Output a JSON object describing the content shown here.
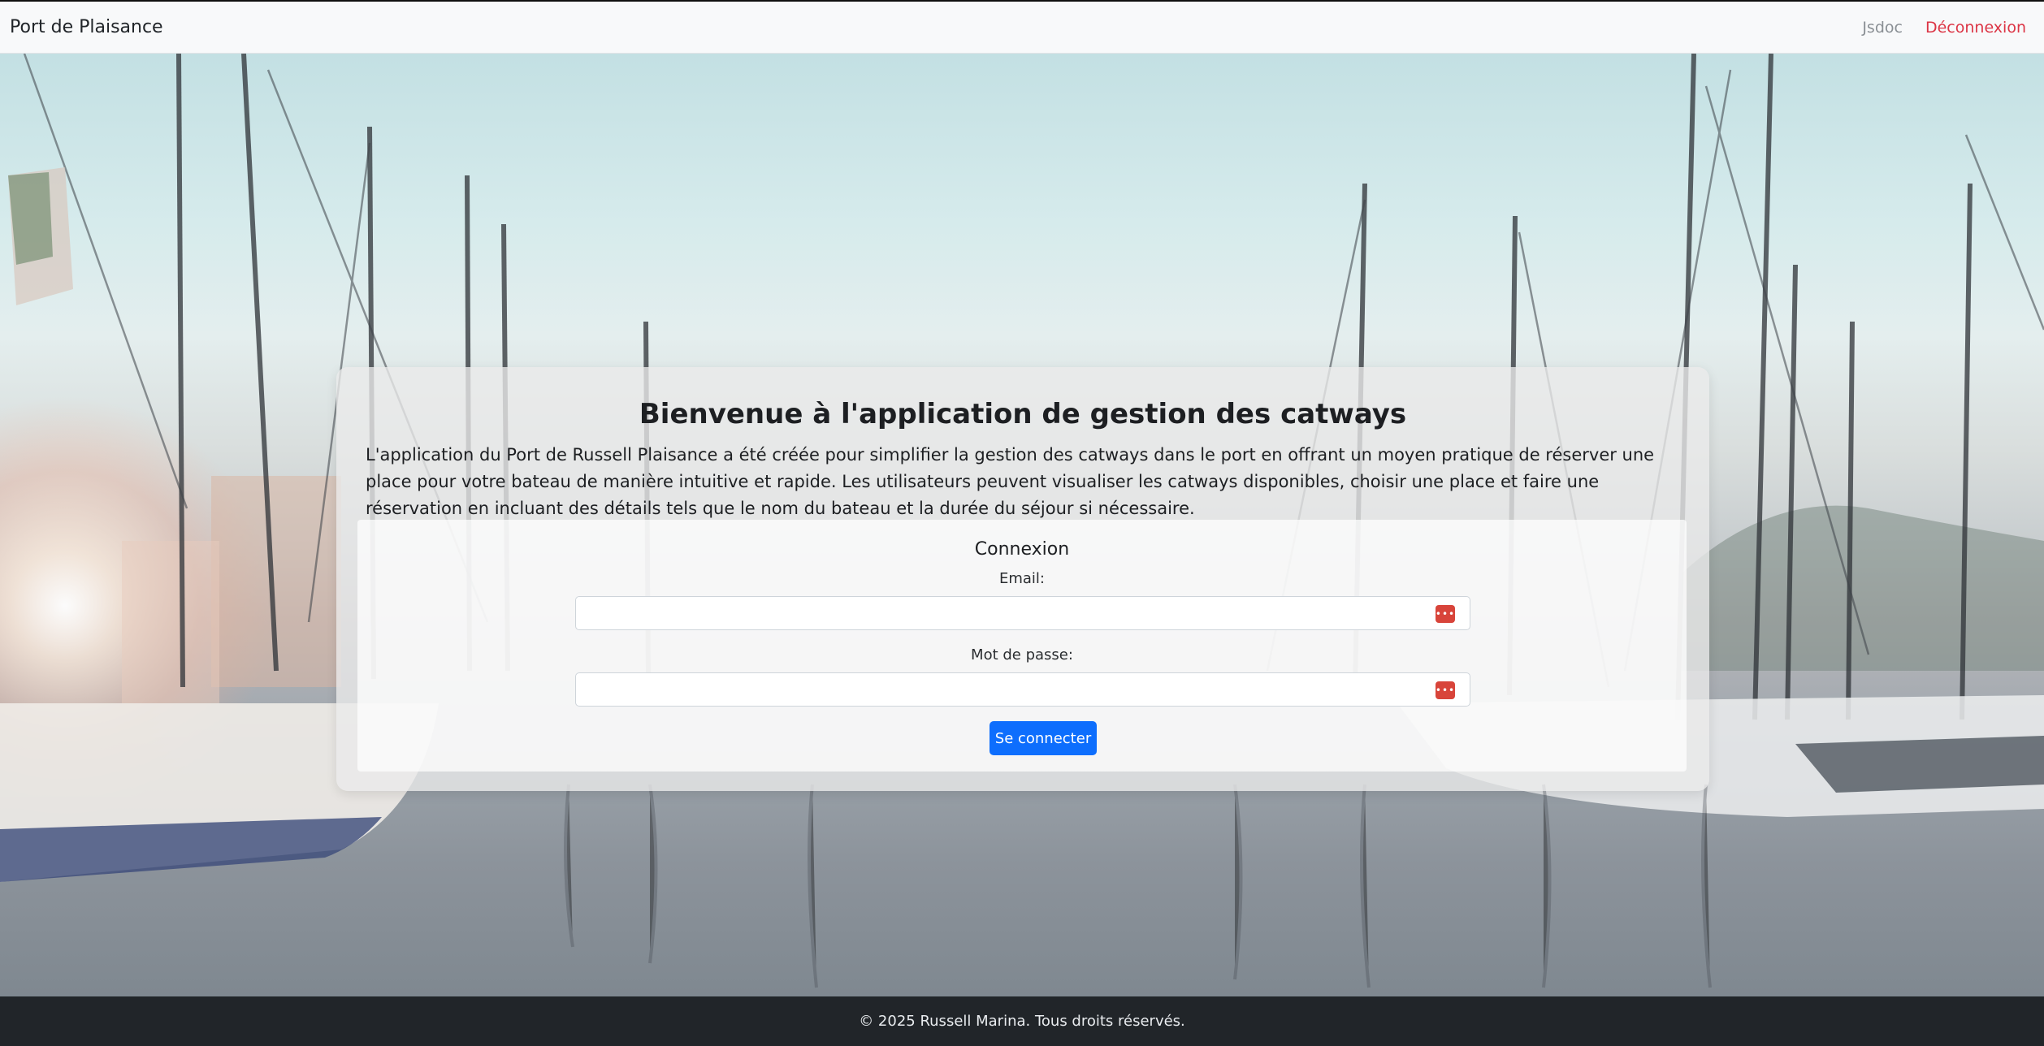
{
  "navbar": {
    "brand": "Port de Plaisance",
    "links": {
      "jsdoc": "Jsdoc",
      "logout": "Déconnexion"
    }
  },
  "main": {
    "title": "Bienvenue à l'application de gestion des catways",
    "description": "L'application du Port de Russell Plaisance a été créée pour simplifier la gestion des catways dans le port en offrant un moyen pratique de réserver une place pour votre bateau de manière intuitive et rapide. Les utilisateurs peuvent visualiser les catways disponibles, choisir une place et faire une réservation en incluant des détails tels que le nom du bateau et la durée du séjour si nécessaire."
  },
  "login": {
    "title": "Connexion",
    "email_label": "Email:",
    "email_value": "",
    "password_label": "Mot de passe:",
    "password_value": "",
    "submit_label": "Se connecter",
    "password_manager_icon": "password-manager-icon"
  },
  "footer": {
    "text": "© 2025 Russell Marina. Tous droits réservés."
  },
  "colors": {
    "primary": "#0d6efd",
    "logout": "#dc3545",
    "footer_bg": "#212529",
    "navbar_bg": "#f8f9fa"
  }
}
